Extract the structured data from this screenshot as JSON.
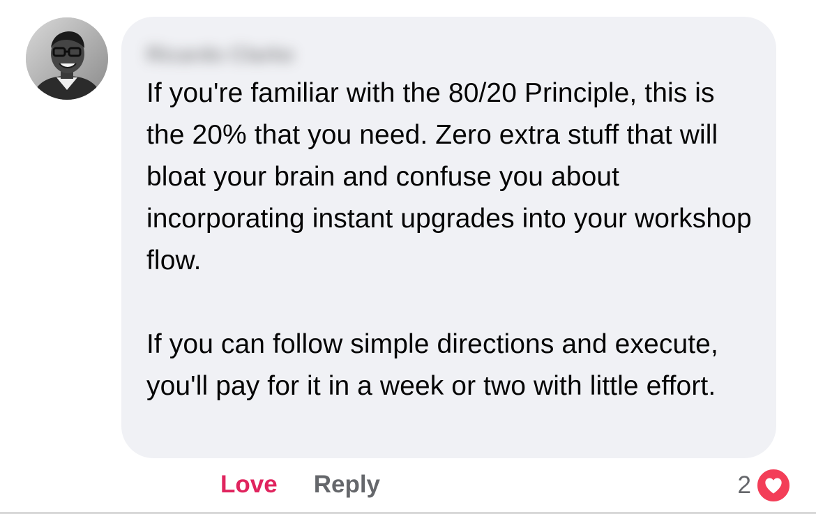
{
  "comment": {
    "author_name": "Ricardo Clarke",
    "paragraphs": [
      "If you're familiar with the 80/20 Principle, this is the 20% that you need. Zero extra stuff that will bloat your brain and confuse you about incorporating instant upgrades into your workshop flow.",
      "If you can follow simple directions and execute, you'll pay for it in a week or two with little effort."
    ]
  },
  "actions": {
    "love_label": "Love",
    "reply_label": "Reply"
  },
  "reactions": {
    "count": "2",
    "icon": "heart-icon",
    "color": "#f33e58"
  },
  "colors": {
    "love": "#e0245e",
    "bubble": "#f0f1f5"
  }
}
